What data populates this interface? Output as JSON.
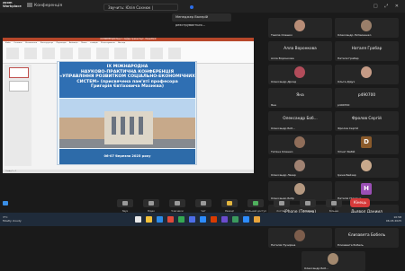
{
  "app": {
    "logo_line1": "zoom",
    "logo_line2": "Workplace",
    "conference_label": "Конференція",
    "view_label": "Звучить: Юлія Сахнюк |",
    "top_right": "□ ⤢ ✕"
  },
  "toast": "Менеджер Валерій реєструвається...",
  "powerpoint": {
    "title_bar": "КОНФЕРЕНЦІЯ Макет слайдів презентації - PowerPoint",
    "ribbon_tabs": "Файл Основне Вставлення Конструктор Переходи Анімація Показ слайдів Рецензування Вигляд",
    "status": "Слайд 1 з 1",
    "slide": {
      "line1": "IX МІЖНАРОДНА",
      "line2": "НАУКОВО-ПРАКТИЧНА КОНФЕРЕНЦІЯ",
      "line3": "«УПРАВЛІННЯ РОЗВИТКОМ СОЦІАЛЬНО-ЕКОНОМІЧНИХ",
      "line4": "СИСТЕМ» (присвячена пам'яті професора",
      "line5": "Григорія Євтіховича Мазнєва)",
      "date": "06-07 березня 2025 року"
    }
  },
  "participants": [
    {
      "name": "Таміла Олешко",
      "big": "",
      "avatar_color": "#b88d77"
    },
    {
      "name": "Олександр Литвиненко",
      "big": "",
      "avatar_color": "#9a7f6a"
    },
    {
      "name": "Алла Воронкова",
      "big": "Алла Воронкова",
      "avatar_color": ""
    },
    {
      "name": "Наталя Грабар",
      "big": "Наталя Грабар",
      "avatar_color": ""
    },
    {
      "name": "Олександр Дрозд",
      "big": "",
      "avatar_color": "#b24c5a"
    },
    {
      "name": "Ольга Дідух",
      "big": "",
      "avatar_color": "#c59b86"
    },
    {
      "name": "Яна",
      "big": "Яна",
      "avatar_color": ""
    },
    {
      "name": "p490700",
      "big": "p490700",
      "avatar_color": ""
    },
    {
      "name": "Олександр Боб...",
      "big": "Олександр Боб...",
      "avatar_color": ""
    },
    {
      "name": "Фролов Сергій",
      "big": "Фролов Сергій",
      "avatar_color": ""
    },
    {
      "name": "Тетяна Олешко",
      "big": "",
      "avatar_color": "#8f6d59"
    },
    {
      "name": "Зігнат Бабій",
      "big": "",
      "avatar_color": "#8a5a2b",
      "letter": "D"
    },
    {
      "name": "Олександр Лазар",
      "big": "",
      "avatar_color": "#a08272"
    },
    {
      "name": "Ірина Бейзер",
      "big": "",
      "avatar_color": "#c9a98c"
    },
    {
      "name": "Олександр Бобр",
      "big": "",
      "avatar_color": "#b49880"
    },
    {
      "name": "Наталія Підгірна",
      "big": "",
      "avatar_color": "#9b4fb5",
      "letter": "H"
    },
    {
      "name": "iPhone (Тетяна)",
      "big": "iPhone (Тетяна)",
      "avatar_color": ""
    },
    {
      "name": "Дьявол Даниил",
      "big": "Дьявол Даниил",
      "avatar_color": ""
    },
    {
      "name": "Наталія Пузиріна",
      "big": "",
      "avatar_color": "#7c5d4c"
    },
    {
      "name": "Єлизавета Бобель",
      "big": "Єлизавета Бобель",
      "avatar_color": ""
    },
    {
      "name": "Олександр Боб...",
      "big": "",
      "avatar_color": "#a3896f"
    }
  ],
  "controls": {
    "left_line1": "3°C",
    "left_line2": "Mostly cloudy",
    "buttons": [
      {
        "label": "Звук",
        "color": "#9a9a9a"
      },
      {
        "label": "Відео",
        "color": "#9a9a9a"
      },
      {
        "label": "Учасники",
        "color": "#9a9a9a"
      },
      {
        "label": "Чат",
        "color": "#9a9a9a"
      },
      {
        "label": "Реакції",
        "color": "#e3b63f"
      },
      {
        "label": "Спільний доступ",
        "color": "#4fb05d"
      },
      {
        "label": "Хостинг",
        "color": "#9a9a9a"
      },
      {
        "label": "Додатки",
        "color": "#9a9a9a"
      },
      {
        "label": "Більше",
        "color": "#9a9a9a"
      }
    ],
    "end_label": "Кінець"
  },
  "taskbar": {
    "weather_temp": "3°C",
    "weather_desc": "Mostly cloudy",
    "icons": [
      "#e8e8e8",
      "#f3c13a",
      "#2c8be8",
      "#e04a3a",
      "#34a853",
      "#4d6ee8",
      "#2d8cff",
      "#d83b01",
      "#6b4ccf",
      "#3b9a5e",
      "#2d8cff",
      "#e8a43b"
    ],
    "time": "10:58",
    "date": "06.03.2025"
  }
}
